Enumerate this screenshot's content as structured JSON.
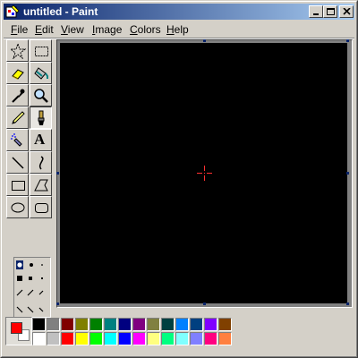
{
  "window": {
    "title": "untitled - Paint",
    "icon": "paint-app-icon",
    "controls": [
      "minimize-icon",
      "maximize-icon",
      "close-icon"
    ]
  },
  "menu": {
    "items": [
      {
        "label": "File",
        "ul": "F",
        "rest": "ile"
      },
      {
        "label": "Edit",
        "ul": "E",
        "rest": "dit"
      },
      {
        "label": "View",
        "ul": "V",
        "rest": "iew"
      },
      {
        "label": "Image",
        "ul": "I",
        "rest": "mage"
      },
      {
        "label": "Colors",
        "ul": "C",
        "rest": "olors"
      },
      {
        "label": "Help",
        "ul": "H",
        "rest": "elp"
      }
    ]
  },
  "toolbox": {
    "tools": [
      {
        "name": "free-form-select",
        "icon": "star-select-icon",
        "pressed": false
      },
      {
        "name": "rect-select",
        "icon": "rect-select-icon",
        "pressed": false
      },
      {
        "name": "eraser",
        "icon": "eraser-icon",
        "pressed": false
      },
      {
        "name": "fill",
        "icon": "fill-bucket-icon",
        "pressed": false
      },
      {
        "name": "pick-color",
        "icon": "eyedropper-icon",
        "pressed": false
      },
      {
        "name": "magnifier",
        "icon": "magnifier-icon",
        "pressed": false
      },
      {
        "name": "pencil",
        "icon": "pencil-icon",
        "pressed": false
      },
      {
        "name": "brush",
        "icon": "brush-icon",
        "pressed": true
      },
      {
        "name": "airbrush",
        "icon": "airbrush-icon",
        "pressed": false
      },
      {
        "name": "text",
        "icon": "text-icon",
        "label": "A",
        "pressed": false
      },
      {
        "name": "line",
        "icon": "line-icon",
        "pressed": false
      },
      {
        "name": "curve",
        "icon": "curve-icon",
        "pressed": false
      },
      {
        "name": "rectangle",
        "icon": "rectangle-icon",
        "pressed": false
      },
      {
        "name": "polygon",
        "icon": "polygon-icon",
        "pressed": false
      },
      {
        "name": "ellipse",
        "icon": "ellipse-icon",
        "pressed": false
      },
      {
        "name": "rounded-rectangle",
        "icon": "rounded-rect-icon",
        "pressed": false
      }
    ],
    "brush_options_icon": "brush-shapes-icon"
  },
  "canvas": {
    "background": "#000000",
    "cursor": "crosshair-cursor-icon",
    "cursor_color": "#ff3030"
  },
  "colors": {
    "foreground": "#ff0000",
    "background": "#ffffff",
    "palette_row1": [
      "#000000",
      "#808080",
      "#800000",
      "#808000",
      "#008000",
      "#008080",
      "#000080",
      "#800080",
      "#808040",
      "#004040",
      "#0080ff",
      "#004080",
      "#8000ff",
      "#804000"
    ],
    "palette_row2": [
      "#ffffff",
      "#c0c0c0",
      "#ff0000",
      "#ffff00",
      "#00ff00",
      "#00ffff",
      "#0000ff",
      "#ff00ff",
      "#ffff80",
      "#00ff80",
      "#80ffff",
      "#8080ff",
      "#ff0080",
      "#ff8040"
    ]
  }
}
